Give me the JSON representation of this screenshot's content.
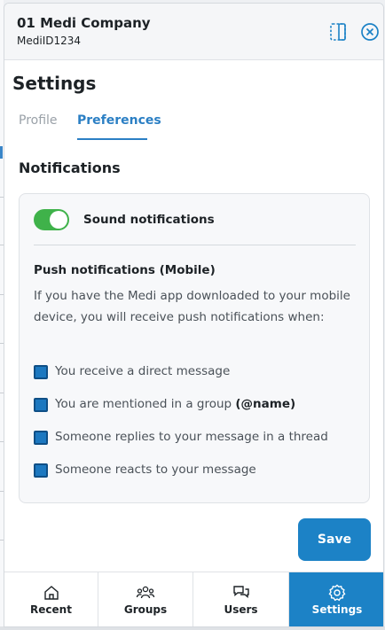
{
  "header": {
    "company_name": "01 Medi Company",
    "medi_id": "MediID1234"
  },
  "page": {
    "title": "Settings"
  },
  "tabs": [
    {
      "label": "Profile",
      "active": false
    },
    {
      "label": "Preferences",
      "active": true
    }
  ],
  "notifications": {
    "section_title": "Notifications",
    "sound": {
      "label": "Sound notifications",
      "enabled": true
    },
    "push": {
      "title": "Push notifications (Mobile)",
      "description": "If you have the Medi app downloaded to your mobile device, you will receive push notifications when:",
      "options": [
        {
          "label": "You receive a direct message",
          "checked": true
        },
        {
          "label": "You are mentioned in a group",
          "suffix": "(@name)",
          "checked": true
        },
        {
          "label": "Someone replies to your message in a thread",
          "checked": true
        },
        {
          "label": "Someone reacts to your message",
          "checked": true
        }
      ]
    }
  },
  "actions": {
    "save_label": "Save"
  },
  "bottom_nav": [
    {
      "label": "Recent",
      "icon": "home-icon",
      "active": false
    },
    {
      "label": "Groups",
      "icon": "groups-icon",
      "active": false
    },
    {
      "label": "Users",
      "icon": "chat-bubbles-icon",
      "active": false
    },
    {
      "label": "Settings",
      "icon": "gear-icon",
      "active": true
    }
  ],
  "colors": {
    "accent": "#1c82c6",
    "toggle_on": "#3fb24a",
    "tab_active": "#2b7fc4"
  }
}
